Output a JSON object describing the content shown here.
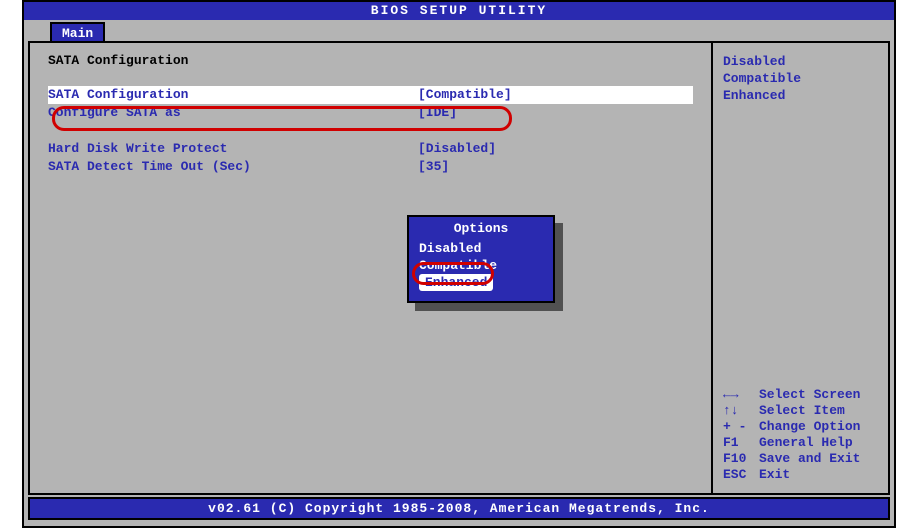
{
  "title": "BIOS SETUP UTILITY",
  "tab": "Main",
  "section_title": "SATA Configuration",
  "rows": [
    {
      "label": "SATA Configuration",
      "value": "[Compatible]",
      "selected": true
    },
    {
      "label": "Configure SATA as",
      "value": "[IDE]"
    },
    {
      "label": "",
      "value": ""
    },
    {
      "label": "Hard Disk Write Protect",
      "value": "[Disabled]"
    },
    {
      "label": "SATA Detect Time Out (Sec)",
      "value": "[35]"
    }
  ],
  "side_options": [
    "Disabled",
    "Compatible",
    "Enhanced"
  ],
  "popup": {
    "title": "Options",
    "items": [
      "Disabled",
      "Compatible",
      "Enhanced"
    ],
    "selected_index": 2
  },
  "help": [
    {
      "k": "←→",
      "d": "Select Screen"
    },
    {
      "k": "↑↓",
      "d": "Select Item"
    },
    {
      "k": "+ -",
      "d": "Change Option"
    },
    {
      "k": "F1",
      "d": "General Help"
    },
    {
      "k": "F10",
      "d": "Save and Exit"
    },
    {
      "k": "ESC",
      "d": "Exit"
    }
  ],
  "footer": "v02.61 (C) Copyright 1985-2008, American Megatrends, Inc."
}
